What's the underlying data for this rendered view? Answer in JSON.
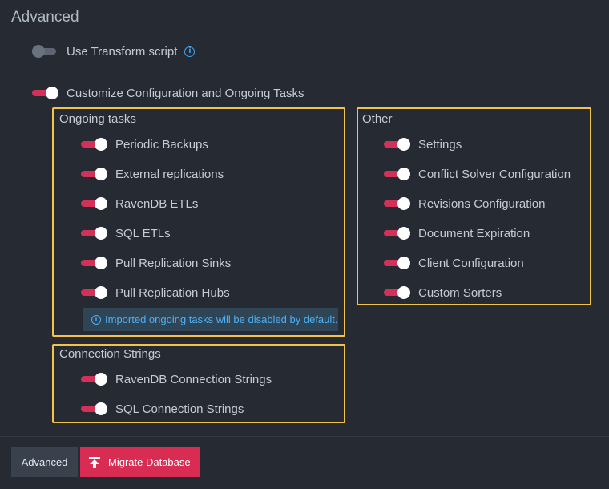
{
  "section_title": "Advanced",
  "transform": {
    "label": "Use Transform script",
    "enabled": false,
    "icon": "info-icon"
  },
  "customize": {
    "label": "Customize Configuration and Ongoing Tasks",
    "enabled": true
  },
  "ongoing_tasks": {
    "title": "Ongoing tasks",
    "items": [
      {
        "label": "Periodic Backups",
        "enabled": true
      },
      {
        "label": "External replications",
        "enabled": true
      },
      {
        "label": "RavenDB ETLs",
        "enabled": true
      },
      {
        "label": "SQL ETLs",
        "enabled": true
      },
      {
        "label": "Pull Replication Sinks",
        "enabled": true
      },
      {
        "label": "Pull Replication Hubs",
        "enabled": true
      }
    ],
    "note": "Imported ongoing tasks will be disabled by default."
  },
  "other": {
    "title": "Other",
    "items": [
      {
        "label": "Settings",
        "enabled": true
      },
      {
        "label": "Conflict Solver Configuration",
        "enabled": true
      },
      {
        "label": "Revisions Configuration",
        "enabled": true
      },
      {
        "label": "Document Expiration",
        "enabled": true
      },
      {
        "label": "Client Configuration",
        "enabled": true
      },
      {
        "label": "Custom Sorters",
        "enabled": true
      }
    ]
  },
  "connection_strings": {
    "title": "Connection Strings",
    "items": [
      {
        "label": "RavenDB Connection Strings",
        "enabled": true
      },
      {
        "label": "SQL Connection Strings",
        "enabled": true
      }
    ]
  },
  "buttons": {
    "advanced": "Advanced",
    "migrate": "Migrate Database",
    "migrate_icon": "upload-icon"
  },
  "colors": {
    "background": "#262b33",
    "toggle_on": "#d3315a",
    "toggle_off": "#5d6572",
    "group_border": "#f2c24b",
    "info_blue": "#3ea6f5",
    "migrate_button": "#d82c53"
  }
}
